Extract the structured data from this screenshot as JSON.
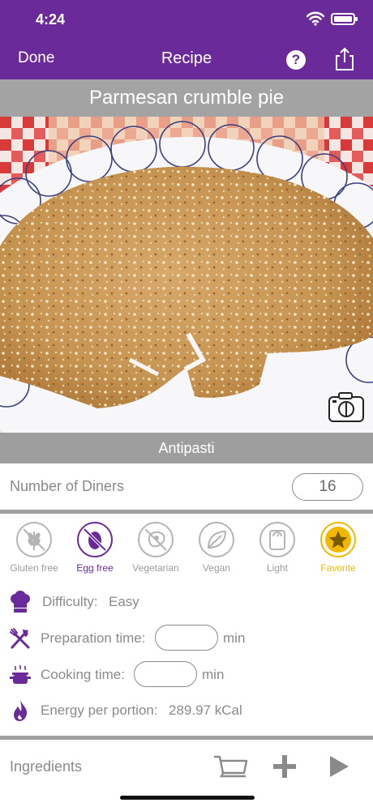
{
  "status_bar": {
    "time": "4:24"
  },
  "nav": {
    "done_label": "Done",
    "title": "Recipe",
    "help_symbol": "?"
  },
  "recipe": {
    "title": "Parmesan crumble pie",
    "category": "Antipasti"
  },
  "diners": {
    "label": "Number of Diners",
    "value": "16"
  },
  "tags": [
    {
      "label": "Gluten free",
      "icon": "wheat-icon",
      "state": "off"
    },
    {
      "label": "Egg free",
      "icon": "egg-icon",
      "state": "on"
    },
    {
      "label": "Vegetarian",
      "icon": "meat-icon",
      "state": "off"
    },
    {
      "label": "Vegan",
      "icon": "leaf-icon",
      "state": "off"
    },
    {
      "label": "Light",
      "icon": "scale-icon",
      "state": "off"
    },
    {
      "label": "Favorite",
      "icon": "star-icon",
      "state": "favorite"
    }
  ],
  "difficulty": {
    "label": "Difficulty:",
    "value": "Easy"
  },
  "prep_time": {
    "label": "Preparation time:",
    "value": "",
    "unit": "min"
  },
  "cooking_time": {
    "label": "Cooking time:",
    "value": "",
    "unit": "min"
  },
  "energy": {
    "label": "Energy per portion:",
    "value": "289.97 kCal"
  },
  "bottom": {
    "ingredients_label": "Ingredients"
  },
  "colors": {
    "accent": "#6a2a9a",
    "favorite": "#f2b800",
    "header_gray": "#a3a3a3",
    "text_gray": "#8a8a8a"
  }
}
